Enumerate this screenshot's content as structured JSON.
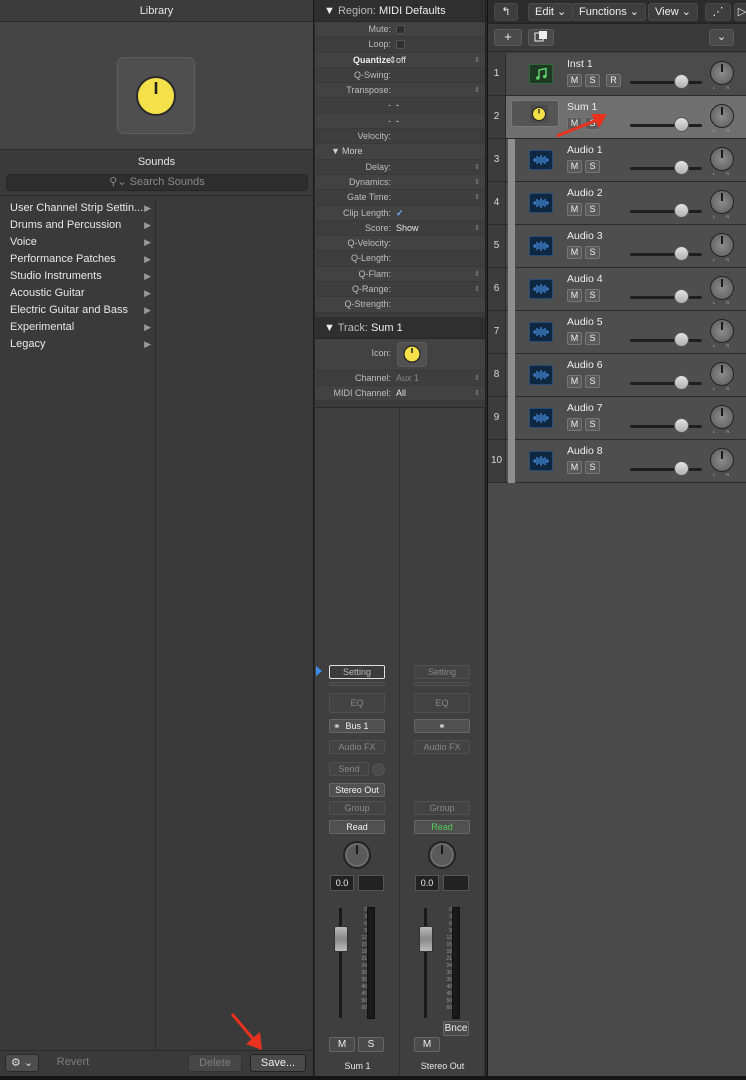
{
  "library": {
    "title": "Library",
    "sounds_label": "Sounds",
    "search_placeholder": "Search Sounds",
    "categories": [
      {
        "label": "User Channel Strip Settin..."
      },
      {
        "label": "Drums and Percussion"
      },
      {
        "label": "Voice"
      },
      {
        "label": "Performance Patches"
      },
      {
        "label": "Studio Instruments"
      },
      {
        "label": "Acoustic Guitar"
      },
      {
        "label": "Electric Guitar and Bass"
      },
      {
        "label": "Experimental"
      },
      {
        "label": "Legacy"
      }
    ],
    "buttons": {
      "gear": "⚙",
      "revert": "Revert",
      "delete": "Delete",
      "save": "Save..."
    }
  },
  "region": {
    "header_label": "Region:",
    "header_value": "MIDI Defaults",
    "rows": [
      {
        "key": "Mute:",
        "value": ""
      },
      {
        "key": "Loop:",
        "value": ""
      },
      {
        "key": "Quantize",
        "value": "off"
      },
      {
        "key": "Q-Swing:",
        "value": ""
      },
      {
        "key": "Transpose:",
        "value": ""
      },
      {
        "key": "-",
        "value": "-"
      },
      {
        "key": "-",
        "value": "-"
      },
      {
        "key": "Velocity:",
        "value": ""
      },
      {
        "key": "More",
        "value": ""
      },
      {
        "key": "Delay:",
        "value": ""
      },
      {
        "key": "Dynamics:",
        "value": ""
      },
      {
        "key": "Gate Time:",
        "value": ""
      },
      {
        "key": "Clip Length:",
        "value": "✓"
      },
      {
        "key": "Score:",
        "value": "Show"
      },
      {
        "key": "Q-Velocity:",
        "value": ""
      },
      {
        "key": "Q-Length:",
        "value": ""
      },
      {
        "key": "Q-Flam:",
        "value": ""
      },
      {
        "key": "Q-Range:",
        "value": ""
      },
      {
        "key": "Q-Strength:",
        "value": ""
      }
    ]
  },
  "track": {
    "header_label": "Track:",
    "header_value": "Sum 1",
    "icon_label": "Icon:",
    "channel_label": "Channel:",
    "channel_value": "Aux 1",
    "midi_channel_label": "MIDI Channel:",
    "midi_channel_value": "All"
  },
  "strips": [
    {
      "setting": "Setting",
      "eq": "EQ",
      "input": "Bus 1",
      "audio_fx": "Audio FX",
      "send": "Send",
      "output": "Stereo Out",
      "group": "Group",
      "automation": "Read",
      "volume": "0.0",
      "mute": "M",
      "solo": "S",
      "name": "Sum 1"
    },
    {
      "setting": "Setting",
      "eq": "EQ",
      "input": "",
      "audio_fx": "Audio FX",
      "group": "Group",
      "automation": "Read",
      "volume": "0.0",
      "bounce": "Bnce",
      "mute": "M",
      "name": "Stereo Out"
    }
  ],
  "meter_scale": [
    "0",
    "3",
    "6",
    "9",
    "12",
    "15",
    "18",
    "21",
    "24",
    "30",
    "35",
    "40",
    "45",
    "50",
    "60"
  ],
  "tracks_area": {
    "menu": {
      "edit": "Edit",
      "functions": "Functions",
      "view": "View"
    },
    "toolbar": {
      "add": "+",
      "expand": "⌄"
    },
    "mute": "M",
    "solo": "S",
    "record": "R",
    "knob_lr": "L R",
    "tracks": [
      {
        "num": "1",
        "name": "Inst 1",
        "type": "instrument",
        "volume": 0.72
      },
      {
        "num": "2",
        "name": "Sum 1",
        "type": "summing",
        "volume": 0.72
      },
      {
        "num": "3",
        "name": "Audio 1",
        "type": "audio",
        "volume": 0.72
      },
      {
        "num": "4",
        "name": "Audio 2",
        "type": "audio",
        "volume": 0.72
      },
      {
        "num": "5",
        "name": "Audio 3",
        "type": "audio",
        "volume": 0.72
      },
      {
        "num": "6",
        "name": "Audio 4",
        "type": "audio",
        "volume": 0.72
      },
      {
        "num": "7",
        "name": "Audio 5",
        "type": "audio",
        "volume": 0.72
      },
      {
        "num": "8",
        "name": "Audio 6",
        "type": "audio",
        "volume": 0.72
      },
      {
        "num": "9",
        "name": "Audio 7",
        "type": "audio",
        "volume": 0.72
      },
      {
        "num": "10",
        "name": "Audio 8",
        "type": "audio",
        "volume": 0.72
      }
    ]
  },
  "colors": {
    "accent_yellow": "#f4e048",
    "annotation_red": "#e8321e",
    "green_read": "#4fd05a",
    "selection_blue": "#3d8ef0"
  }
}
